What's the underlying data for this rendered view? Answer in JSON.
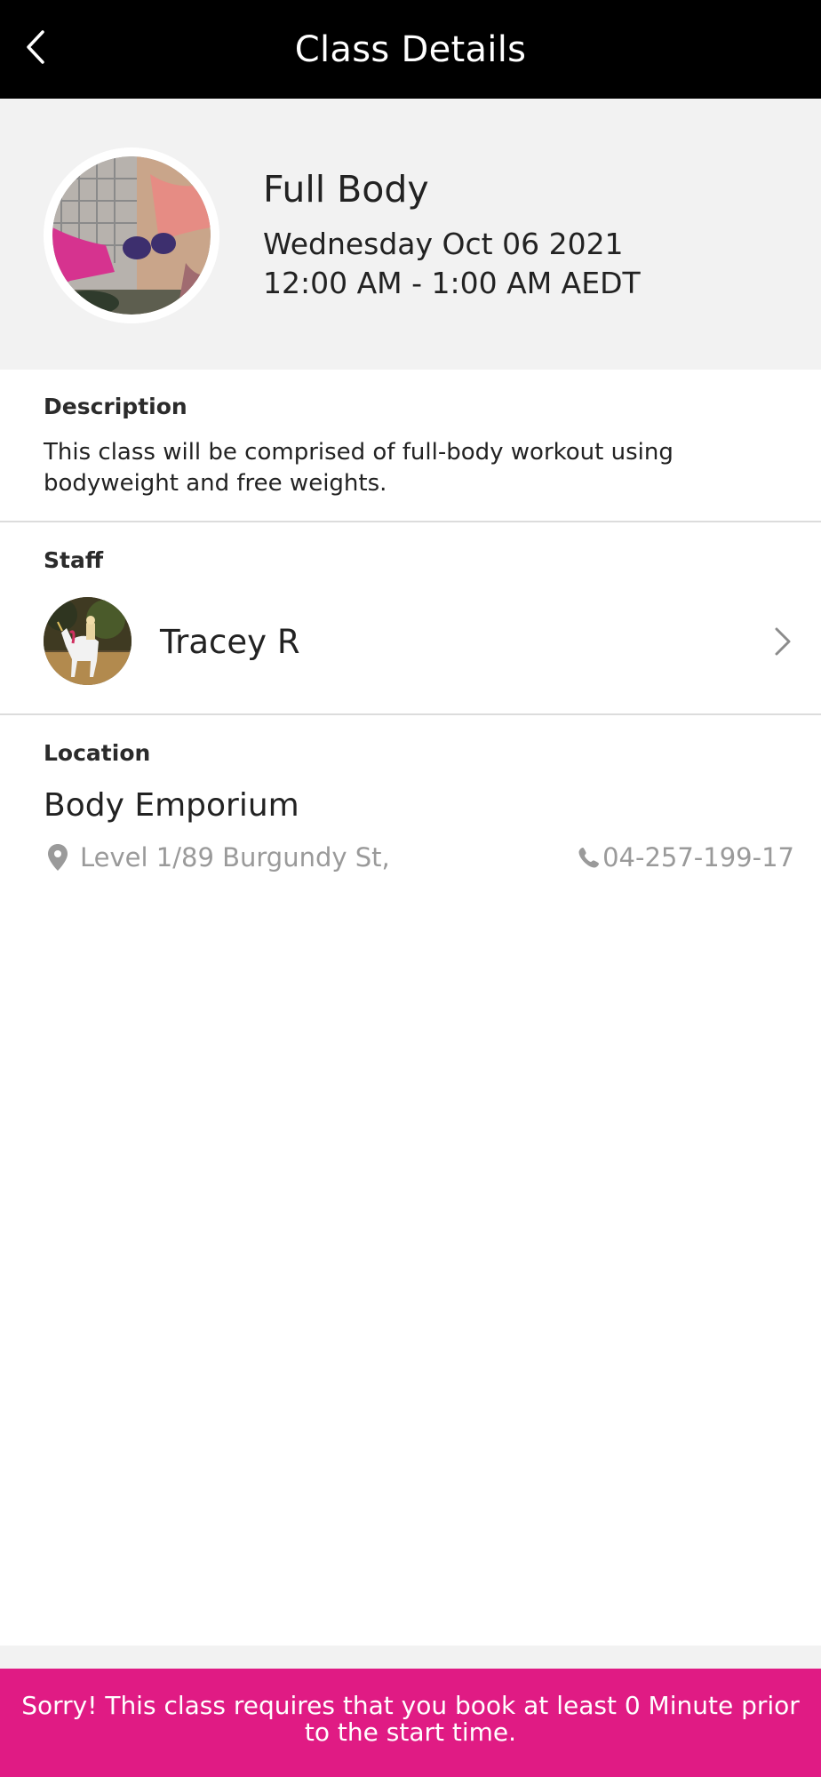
{
  "header": {
    "title": "Class Details",
    "back_icon": "chevron-left-icon"
  },
  "class_info": {
    "name": "Full Body",
    "date": "Wednesday Oct 06 2021",
    "time": "12:00 AM - 1:00 AM AEDT"
  },
  "description": {
    "label": "Description",
    "text": "This class will be comprised of full-body workout using bodyweight and free weights."
  },
  "staff": {
    "label": "Staff",
    "name": "Tracey R",
    "chevron_icon": "chevron-right-icon"
  },
  "location": {
    "label": "Location",
    "name": "Body Emporium",
    "address": "Level 1/89 Burgundy St,",
    "phone": "04-257-199-17",
    "address_icon": "map-pin-icon",
    "phone_icon": "phone-icon"
  },
  "banner": {
    "message": "Sorry! This class requires that you book at least 0 Minute prior to the start time."
  },
  "colors": {
    "header_bg": "#000000",
    "hero_bg": "#f2f2f2",
    "banner_bg": "#e01b84",
    "muted_text": "#9a9a9a"
  }
}
